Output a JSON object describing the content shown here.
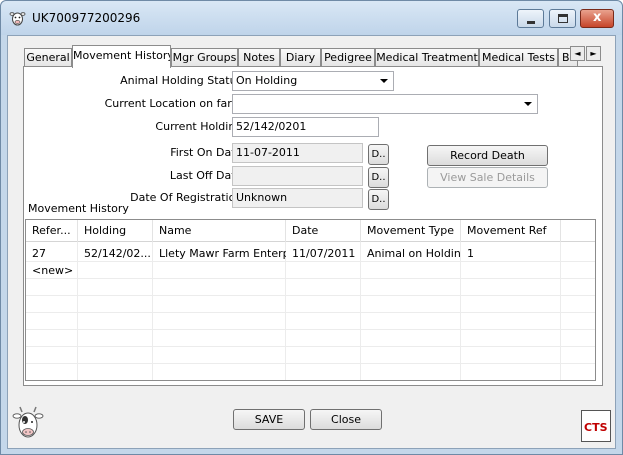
{
  "window": {
    "title": "UK700977200296",
    "close_glyph": "x"
  },
  "tabs": {
    "items": [
      {
        "label": "General"
      },
      {
        "label": "Movement History"
      },
      {
        "label": "Mgr Groups"
      },
      {
        "label": "Notes"
      },
      {
        "label": "Diary"
      },
      {
        "label": "Pedigree"
      },
      {
        "label": "Medical Treatment"
      },
      {
        "label": "Medical Tests"
      },
      {
        "label": "Br"
      }
    ],
    "active": "Movement History",
    "scroll_left": "◄",
    "scroll_right": "►"
  },
  "form": {
    "holding_status_label": "Animal Holding Status:",
    "holding_status_value": "On Holding",
    "location_label": "Current Location on farm:",
    "location_value": "",
    "current_holding_label": "Current Holding:",
    "current_holding_value": "52/142/0201",
    "first_on_label": "First On Date:",
    "first_on_value": "11-07-2011",
    "last_off_label": "Last Off Date:",
    "last_off_value": "",
    "registration_label": "Date Of Registration:",
    "registration_value": "Unknown",
    "date_button_label": "D.."
  },
  "actions": {
    "record_death": "Record Death",
    "view_sale": "View Sale Details"
  },
  "movement_history": {
    "group_label": "Movement History",
    "columns": [
      "Refer...",
      "Holding",
      "Name",
      "Date",
      "Movement Type",
      "Movement Ref"
    ],
    "rows": [
      [
        "27",
        "52/142/02...",
        "Llety Mawr Farm Enterp...",
        "11/07/2011",
        "Animal on Holding",
        "1"
      ],
      [
        "<new>",
        "",
        "",
        "",
        "",
        ""
      ]
    ]
  },
  "footer": {
    "save": "SAVE",
    "close": "Close",
    "logo_text": "CTS"
  },
  "icons": {
    "title": "cow-icon",
    "footer_left": "cow-icon",
    "footer_right": "cts-logo-icon"
  }
}
